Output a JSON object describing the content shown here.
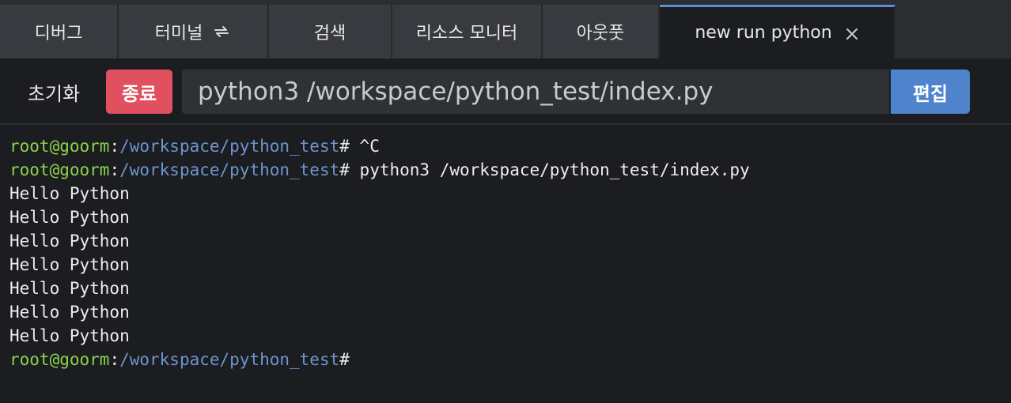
{
  "tabs": [
    {
      "label": "디버그",
      "icon": null,
      "active": false
    },
    {
      "label": "터미널",
      "icon": "sync-icon",
      "active": false
    },
    {
      "label": "검색",
      "icon": null,
      "active": false
    },
    {
      "label": "리소스 모니터",
      "icon": null,
      "active": false
    },
    {
      "label": "아웃풋",
      "icon": null,
      "active": false
    },
    {
      "label": "new run python",
      "icon": "close-icon",
      "active": true
    }
  ],
  "runbar": {
    "reset_label": "초기화",
    "stop_label": "종료",
    "command_value": "python3 /workspace/python_test/index.py",
    "edit_label": "편집"
  },
  "terminal": {
    "prompt_user": "root@goorm",
    "prompt_colon": ":",
    "prompt_path": "/workspace/python_test",
    "prompt_hash": "#",
    "lines": [
      {
        "type": "prompt",
        "command": " ^C"
      },
      {
        "type": "prompt",
        "command": " python3 /workspace/python_test/index.py"
      },
      {
        "type": "output",
        "text": "Hello Python"
      },
      {
        "type": "output",
        "text": "Hello Python"
      },
      {
        "type": "output",
        "text": "Hello Python"
      },
      {
        "type": "output",
        "text": "Hello Python"
      },
      {
        "type": "output",
        "text": "Hello Python"
      },
      {
        "type": "output",
        "text": "Hello Python"
      },
      {
        "type": "output",
        "text": "Hello Python"
      },
      {
        "type": "prompt",
        "command": ""
      }
    ]
  },
  "colors": {
    "accent": "#5b8ddc",
    "stop": "#e0505e",
    "edit": "#4f83cc",
    "prompt_user": "#8bd34b",
    "prompt_path": "#6d95cf"
  }
}
